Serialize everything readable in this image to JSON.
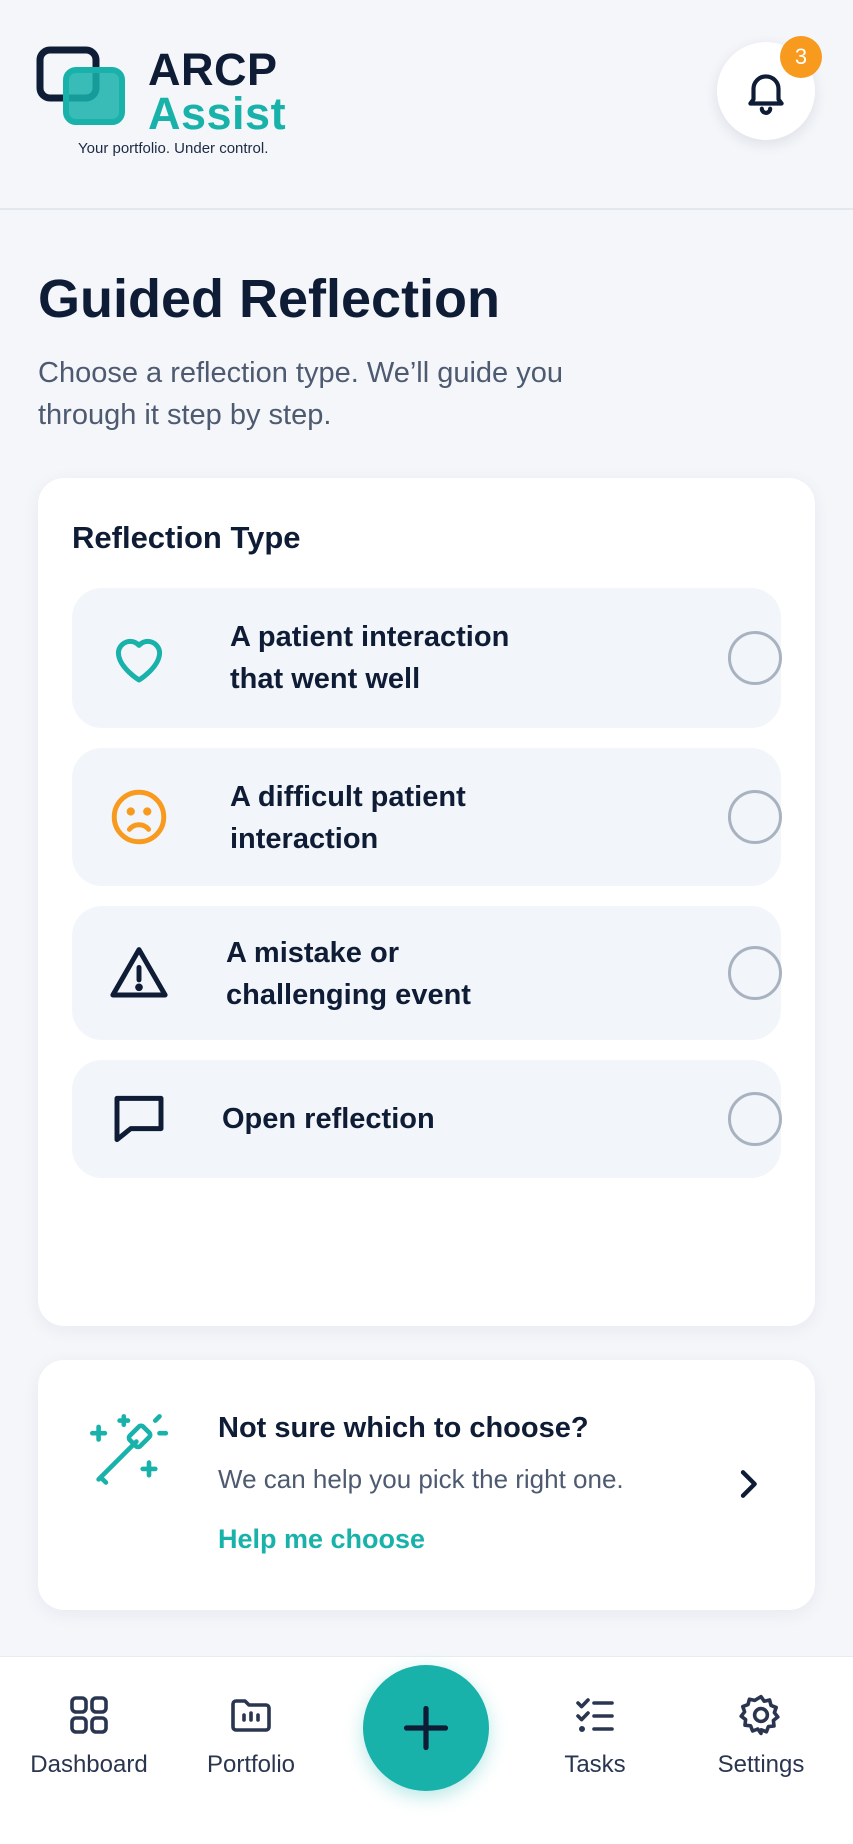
{
  "app": {
    "name_line1": "ARCP",
    "name_line2": "Assist",
    "tagline": "Your portfolio. Under control.",
    "brand_color": "#18b2ab",
    "dark_color": "#0f1c36"
  },
  "header": {
    "notification_icon": "bell-icon",
    "notification_count": "3",
    "badge_color": "#f79a1e"
  },
  "page": {
    "title": "Guided Reflection",
    "subtitle": "Choose a reflection type. We’ll guide you through it step by step."
  },
  "reflection_type": {
    "heading": "Reflection Type",
    "options": [
      {
        "icon": "heart-icon",
        "label": "A patient interaction that went well",
        "selected": false
      },
      {
        "icon": "sad-face-icon",
        "label": "A difficult patient interaction",
        "selected": false
      },
      {
        "icon": "warning-icon",
        "label": "A mistake or challenging event",
        "selected": false
      },
      {
        "icon": "chat-bubble-icon",
        "label": "Open reflection",
        "selected": false
      }
    ]
  },
  "help": {
    "icon": "magic-wand-icon",
    "title": "Not sure which to choose?",
    "description": "We can help you pick the right one.",
    "link": "Help me choose",
    "chevron_icon": "chevron-right-icon"
  },
  "bottom_nav": {
    "items": [
      {
        "icon": "dashboard-icon",
        "label": "Dashboard"
      },
      {
        "icon": "portfolio-icon",
        "label": "Portfolio"
      },
      {
        "icon": "tasks-icon",
        "label": "Tasks"
      },
      {
        "icon": "settings-icon",
        "label": "Settings"
      }
    ],
    "fab_icon": "plus-icon"
  }
}
